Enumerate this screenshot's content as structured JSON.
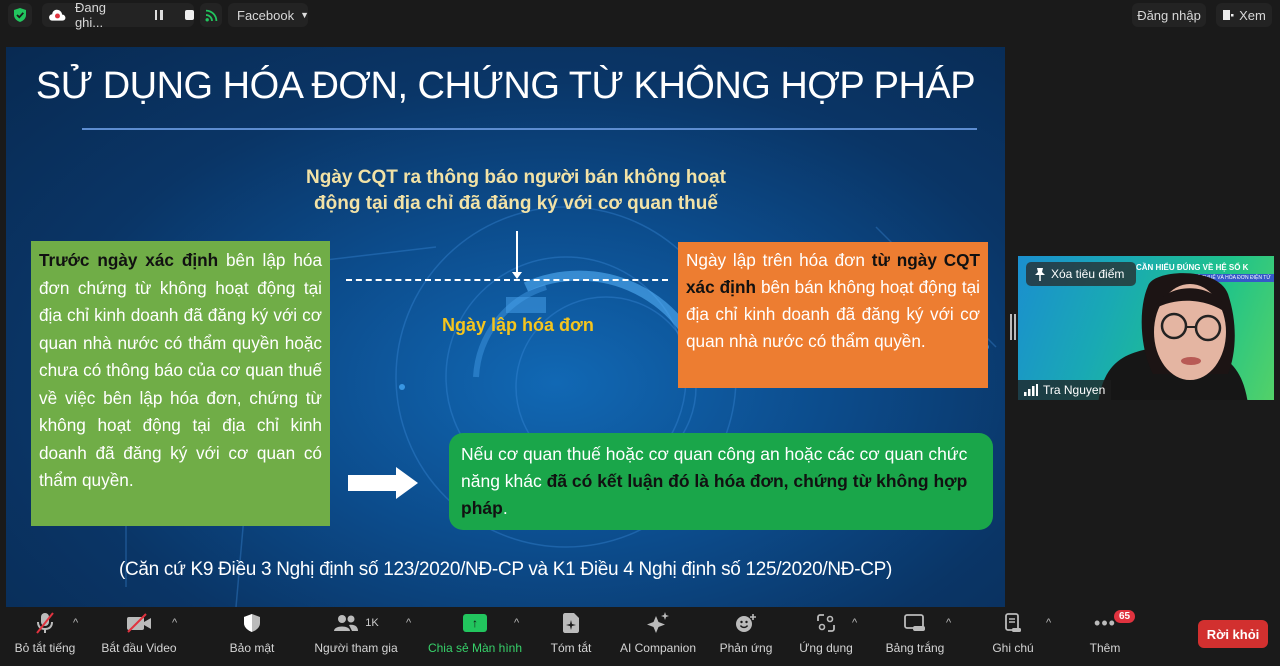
{
  "topbar": {
    "recording_label": "Đang ghi...",
    "stream_target": "Facebook",
    "login_label": "Đăng nhập",
    "view_label": "Xem"
  },
  "slide": {
    "title": "SỬ DỤNG HÓA ĐƠN, CHỨNG TỪ KHÔNG HỢP PHÁP",
    "cqt_note_line1": "Ngày CQT ra thông báo người bán không hoạt",
    "cqt_note_line2": "động tại địa chỉ đã đăng ký với cơ quan thuế",
    "invoice_date_label": "Ngày lập hóa đơn",
    "before_box": {
      "bold": "Trước ngày xác định",
      "text": " bên lập hóa đơn chứng từ không hoạt động tại địa chỉ kinh doanh đã đăng ký với cơ quan nhà nước có thẩm quyền hoặc chưa có thông báo của cơ quan thuế về việc bên lập hóa đơn, chứng từ không hoạt động tại địa chỉ kinh doanh đã đăng ký với cơ quan có thẩm quyền."
    },
    "after_box": {
      "text1": "Ngày lập trên hóa đơn ",
      "bold": "từ ngày CQT xác định",
      "text2": " bên bán không hoạt động tại địa chỉ kinh doanh đã đăng ký với cơ quan nhà nước có thẩm quyền."
    },
    "conclusion_box": {
      "text1": "Nếu cơ quan thuế hoặc cơ quan công an hoặc các cơ quan chức năng khác ",
      "bold": "đã có kết luận đó là hóa đơn, chứng từ không hợp pháp",
      "text2": "."
    },
    "citation": "(Căn cứ K9 Điều 3 Nghị định số 123/2020/NĐ-CP và K1 Điều 4 Nghị định số 125/2020/NĐ-CP)"
  },
  "video": {
    "spotlight_label": "Xóa tiêu điểm",
    "participant_name": "Tra Nguyen",
    "background_banner": "CẦN HIỂU ĐÚNG VỀ HỆ SỐ K",
    "background_sub": "HỖ TRỢ VỀ THUẾ VÀ HÓA ĐƠN ĐIỆN TỬ"
  },
  "toolbar": {
    "items": [
      {
        "label": "Bỏ tắt tiếng",
        "icon": "microphone-muted-icon"
      },
      {
        "label": "Bắt đầu Video",
        "icon": "video-off-icon"
      },
      {
        "label": "Bảo mật",
        "icon": "shield-icon"
      },
      {
        "label": "Người tham gia",
        "icon": "participants-icon",
        "count": "1K"
      },
      {
        "label": "Chia sẻ Màn hình",
        "icon": "share-screen-icon"
      },
      {
        "label": "Tóm tắt",
        "icon": "summary-icon"
      },
      {
        "label": "AI Companion",
        "icon": "sparkle-icon"
      },
      {
        "label": "Phản ứng",
        "icon": "reaction-icon"
      },
      {
        "label": "Ứng dụng",
        "icon": "apps-icon"
      },
      {
        "label": "Bảng trắng",
        "icon": "whiteboard-icon"
      },
      {
        "label": "Ghi chú",
        "icon": "notes-icon"
      },
      {
        "label": "Thêm",
        "icon": "more-icon",
        "badge": "65"
      }
    ],
    "leave_label": "Rời khỏi"
  },
  "colors": {
    "share_green": "#37d16a",
    "leave_red": "#d2302f",
    "box_green": "#70ad47",
    "box_orange": "#ed7d31",
    "box_conclusion": "#1aa64a",
    "slide_title_yellow": "#f2e2a6",
    "invoice_date_yellow": "#f5c51d"
  }
}
